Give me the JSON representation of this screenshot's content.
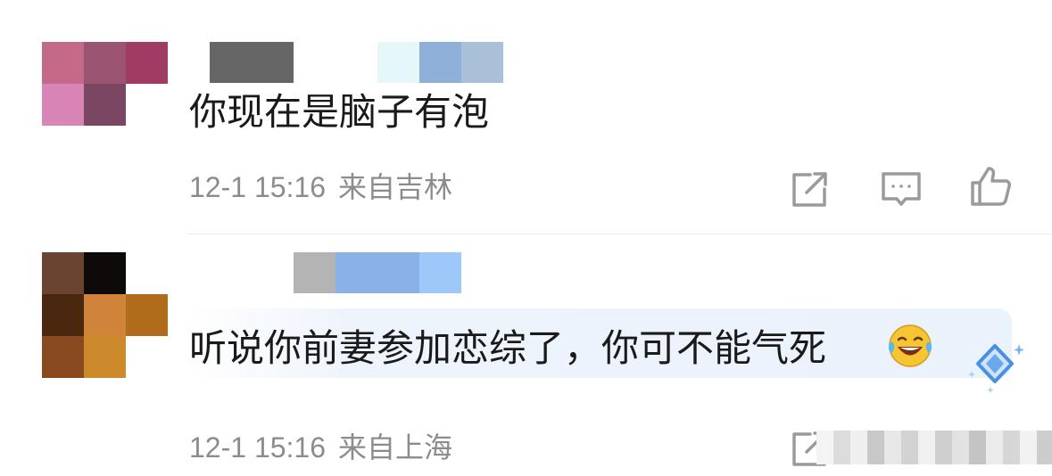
{
  "comments": [
    {
      "text": "你现在是脑子有泡",
      "time": "12-1 15:16",
      "location": "来自吉林",
      "actions": [
        "forward-icon",
        "comment-icon",
        "like-icon"
      ]
    },
    {
      "text": "听说你前妻参加恋综了，你可不能气死",
      "emoji": "😂",
      "time": "12-1 15:16",
      "location": "来自上海",
      "actions": [
        "forward-icon"
      ]
    }
  ],
  "colors": {
    "text": "#1a1a1a",
    "meta": "#8c8c8c",
    "icon": "#9a9a9a",
    "highlight": "#eef4fc",
    "badge": "#4a90e2"
  }
}
